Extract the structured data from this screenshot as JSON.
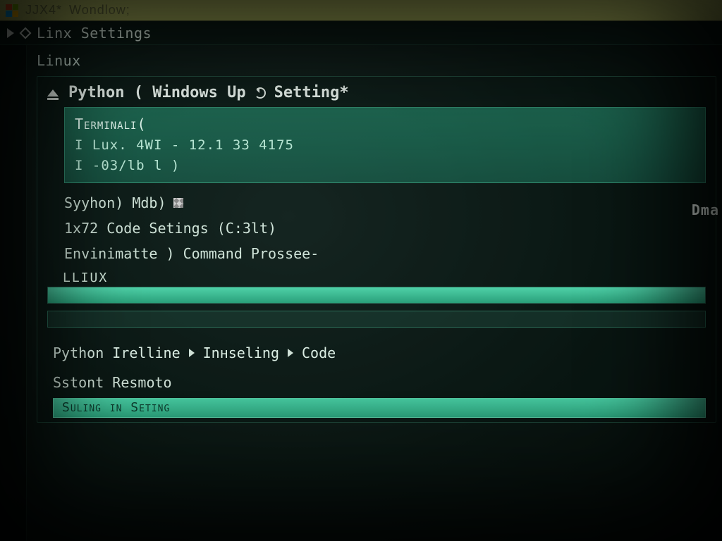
{
  "titlebar": {
    "app_code": "JJX4*",
    "app_mode": "Wondlow;"
  },
  "navbar": {
    "title": "Linx Settings"
  },
  "section": {
    "label": "Linux"
  },
  "group": {
    "header_parts": [
      "Python ( Windows Up",
      "Setting*"
    ],
    "terminal": {
      "line1": "Terminali(",
      "line2": "I Lux. 4WI - 12.1 33 4175",
      "line3": "I  -03/lb l )"
    },
    "rows": [
      "Syyhon)      Mdb)",
      "1x72 Code Setings (C:3lt)",
      "Envinimatte )  Command Prossee-"
    ]
  },
  "bars": {
    "label": "LLIUX"
  },
  "crumbs": [
    "Python Irelline",
    "Inнseling",
    "Code"
  ],
  "footer": {
    "row": "Sstont Resmoto",
    "bar_label": "Suling in Seting"
  },
  "edge": {
    "label": "Dma"
  }
}
